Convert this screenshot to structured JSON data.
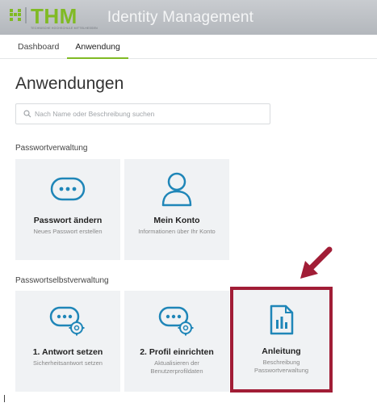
{
  "header": {
    "logo_text": "THM",
    "logo_subtitle": "TECHNISCHE HOCHSCHULE MITTELHESSEN",
    "app_title": "Identity Management"
  },
  "tabs": [
    {
      "label": "Dashboard",
      "active": false
    },
    {
      "label": "Anwendung",
      "active": true
    }
  ],
  "main": {
    "title": "Anwendungen",
    "search": {
      "placeholder": "Nach Name oder Beschreibung suchen"
    },
    "sections": [
      {
        "label": "Passwortverwaltung",
        "tiles": [
          {
            "name": "Passwort ändern",
            "description": "Neues Passwort erstellen",
            "icon": "password-dots-icon"
          },
          {
            "name": "Mein Konto",
            "description": "Informationen über Ihr Konto",
            "icon": "user-icon"
          }
        ]
      },
      {
        "label": "Passwortselbstverwaltung",
        "tiles": [
          {
            "name": "1. Antwort setzen",
            "description": "Sicherheitsantwort setzen",
            "icon": "password-gear-icon"
          },
          {
            "name": "2. Profil einrichten",
            "description": "Aktualisieren der Benutzerprofildaten",
            "icon": "password-gear-icon"
          },
          {
            "name": "Anleitung",
            "description": "Beschreibung Passwortverwaltung",
            "icon": "document-chart-icon"
          }
        ]
      }
    ]
  },
  "colors": {
    "brand_green": "#80ba24",
    "icon_blue": "#1f86b8",
    "highlight_red": "#a11d36"
  }
}
